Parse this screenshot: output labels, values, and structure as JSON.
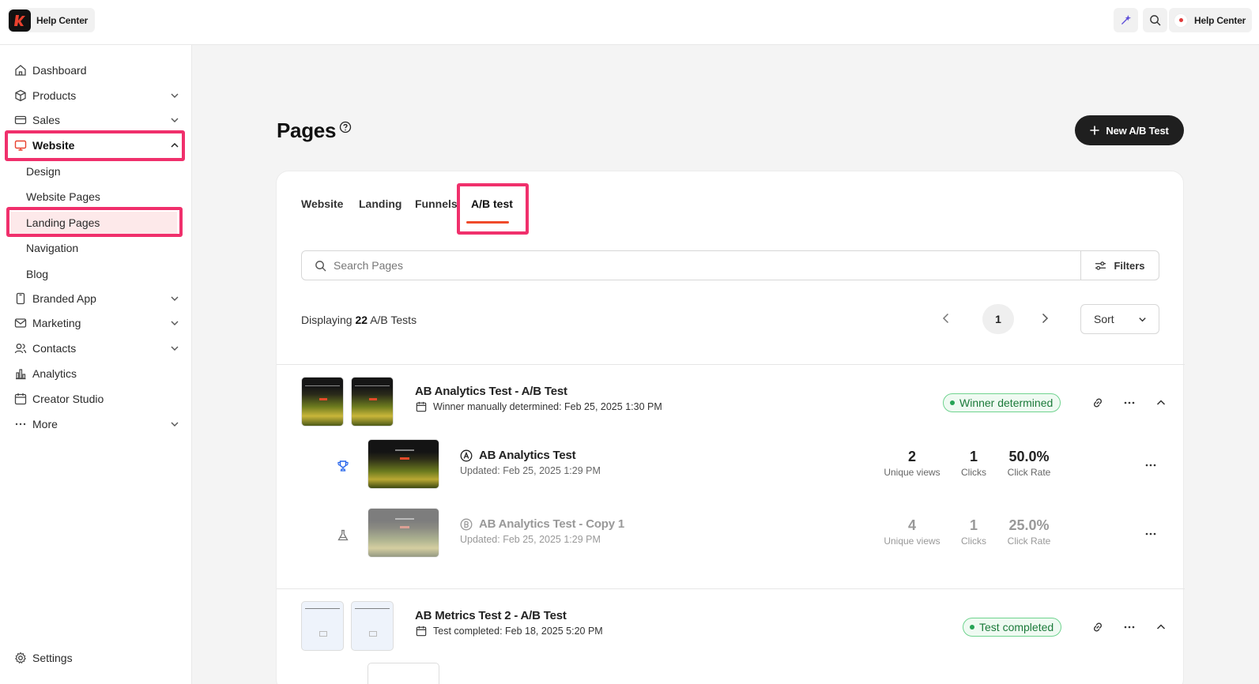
{
  "topbar": {
    "brand_name": "Help Center",
    "user_label": "Help Center"
  },
  "sidebar": {
    "items": [
      {
        "label": "Dashboard"
      },
      {
        "label": "Products"
      },
      {
        "label": "Sales"
      },
      {
        "label": "Website"
      },
      {
        "label": "Branded App"
      },
      {
        "label": "Marketing"
      },
      {
        "label": "Contacts"
      },
      {
        "label": "Analytics"
      },
      {
        "label": "Creator Studio"
      },
      {
        "label": "More"
      }
    ],
    "website_sub": [
      "Design",
      "Website Pages",
      "Landing Pages",
      "Navigation",
      "Blog"
    ],
    "settings_label": "Settings"
  },
  "main": {
    "title": "Pages",
    "new_button": "New A/B Test",
    "tabs": [
      "Website",
      "Landing",
      "Funnels",
      "A/B test"
    ],
    "search_placeholder": "Search Pages",
    "filters_label": "Filters",
    "displaying_prefix": "Displaying",
    "displaying_count": "22",
    "displaying_suffix": "A/B Tests",
    "page_number": "1",
    "sort_label": "Sort"
  },
  "tests": [
    {
      "title": "AB Analytics Test - A/B Test",
      "subtitle": "Winner manually determined: Feb 25, 2025 1:30 PM",
      "badge": "Winner determined",
      "variants": [
        {
          "letter": "A",
          "title": "AB Analytics Test",
          "updated": "Updated: Feb 25, 2025 1:29 PM",
          "unique_views": "2",
          "clicks": "1",
          "click_rate": "50.0%"
        },
        {
          "letter": "B",
          "title": "AB Analytics Test - Copy 1",
          "updated": "Updated: Feb 25, 2025 1:29 PM",
          "unique_views": "4",
          "clicks": "1",
          "click_rate": "25.0%"
        }
      ]
    },
    {
      "title": "AB Metrics Test 2 - A/B Test",
      "subtitle": "Test completed: Feb 18, 2025 5:20 PM",
      "badge": "Test completed"
    }
  ],
  "stat_labels": {
    "unique_views": "Unique views",
    "clicks": "Clicks",
    "click_rate": "Click Rate"
  },
  "colors": {
    "accent_highlight": "#f0306c",
    "tab_underline": "#f04a2a",
    "badge_green": "#27a356",
    "trophy_blue": "#2563eb"
  }
}
